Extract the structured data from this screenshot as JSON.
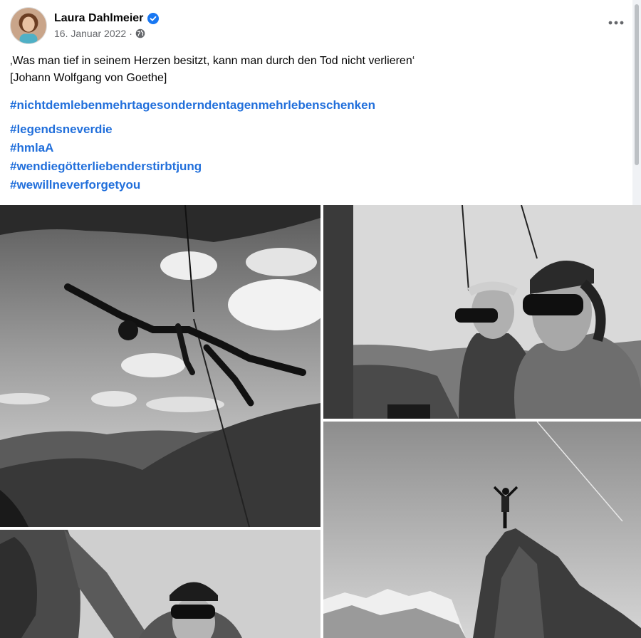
{
  "author": {
    "name": "Laura Dahlmeier",
    "date": "16. Januar 2022",
    "separator": "·",
    "verified_icon": "verified-badge-icon",
    "audience_icon": "globe-icon",
    "brand_blue": "#1877f2"
  },
  "post": {
    "quote_line": "‚Was man tief in seinem Herzen besitzt, kann man durch den Tod nicht verlieren‘",
    "quote_source": "[Johann Wolfgang von Goethe]",
    "hashtag_main": "#nichtdemlebenmehrtagesonderndentagenmehrlebenschenken",
    "hashtags": [
      "#legendsneverdie",
      "#hmlaA",
      "#wendiegötterliebenderstirbtjung",
      "#wewillneverforgetyou"
    ],
    "link_color": "#216fdb"
  },
  "menu": {
    "more_icon": "more-options-icon"
  },
  "photos": [
    {
      "subject": "climber hanging on rope under overhang"
    },
    {
      "subject": "selfie of two climbers with sunglasses"
    },
    {
      "subject": "climber on summit with arms raised"
    },
    {
      "subject": "climber with helmet and sunglasses"
    }
  ]
}
